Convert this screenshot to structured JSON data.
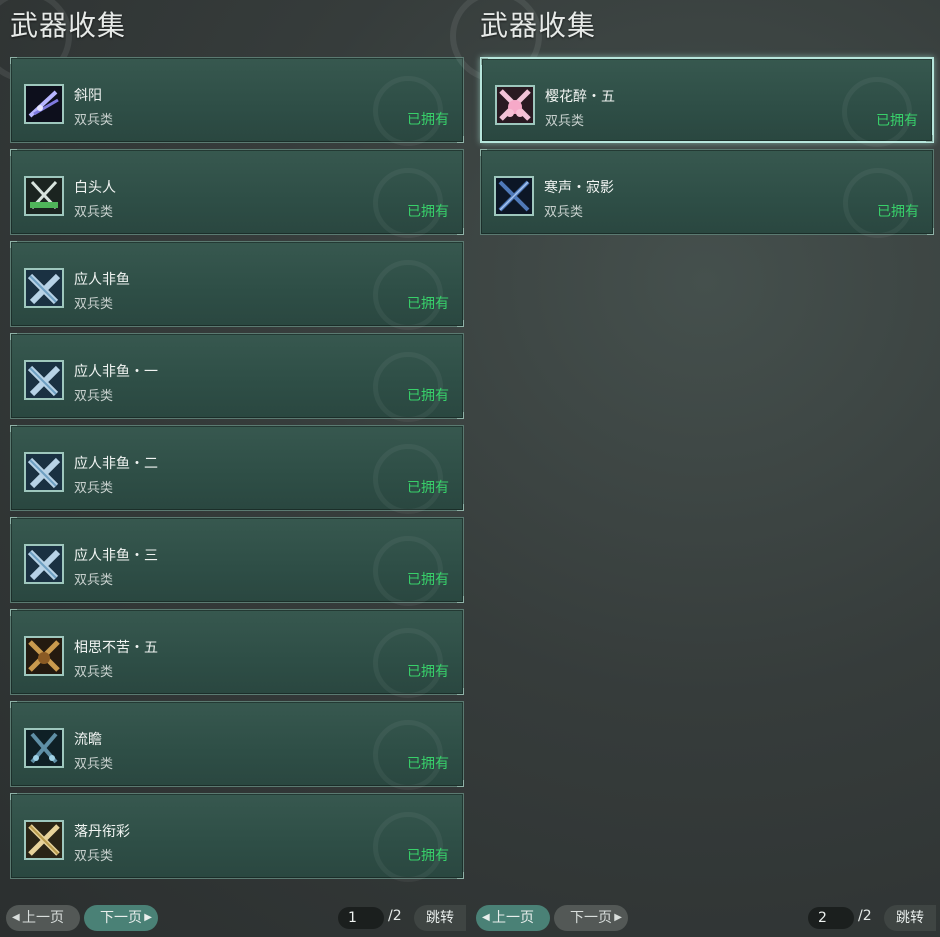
{
  "left_panel": {
    "title": "武器收集",
    "items": [
      {
        "name": "斜阳",
        "type": "双兵类",
        "status": "已拥有",
        "icon": "purple-blade-icon"
      },
      {
        "name": "白头人",
        "type": "双兵类",
        "status": "已拥有",
        "icon": "green-crossed-blades-icon"
      },
      {
        "name": "应人非鱼",
        "type": "双兵类",
        "status": "已拥有",
        "icon": "blue-crossed-blades-icon"
      },
      {
        "name": "应人非鱼・一",
        "type": "双兵类",
        "status": "已拥有",
        "icon": "blue-crossed-blades-icon"
      },
      {
        "name": "应人非鱼・二",
        "type": "双兵类",
        "status": "已拥有",
        "icon": "blue-crossed-blades-icon"
      },
      {
        "name": "应人非鱼・三",
        "type": "双兵类",
        "status": "已拥有",
        "icon": "blue-crossed-blades-icon"
      },
      {
        "name": "相思不苦・五",
        "type": "双兵类",
        "status": "已拥有",
        "icon": "bronze-crossed-blades-icon"
      },
      {
        "name": "流瞻",
        "type": "双兵类",
        "status": "已拥有",
        "icon": "teal-crossed-blades-icon"
      },
      {
        "name": "落丹衔彩",
        "type": "双兵类",
        "status": "已拥有",
        "icon": "gold-crossed-blades-icon"
      }
    ],
    "pager": {
      "prev": "上一页",
      "next": "下一页",
      "page": "1",
      "total": "/2",
      "jump": "跳转"
    }
  },
  "right_panel": {
    "title": "武器收集",
    "items": [
      {
        "name": "樱花醉・五",
        "type": "双兵类",
        "status": "已拥有",
        "icon": "pink-blossom-blades-icon"
      },
      {
        "name": "寒声・寂影",
        "type": "双兵类",
        "status": "已拥有",
        "icon": "dark-blue-crossed-blades-icon"
      }
    ],
    "pager": {
      "prev": "上一页",
      "next": "下一页",
      "page": "2",
      "total": "/2",
      "jump": "跳转"
    }
  },
  "colors": {
    "owned": "#38d06a",
    "card": "#2e4e46",
    "active_button": "#4a8176"
  }
}
